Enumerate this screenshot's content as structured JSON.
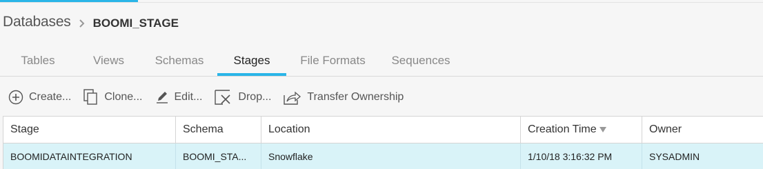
{
  "breadcrumb": {
    "root": "Databases",
    "current": "BOOMI_STAGE"
  },
  "tabs": [
    {
      "label": "Tables",
      "active": false
    },
    {
      "label": "Views",
      "active": false
    },
    {
      "label": "Schemas",
      "active": false
    },
    {
      "label": "Stages",
      "active": true
    },
    {
      "label": "File Formats",
      "active": false
    },
    {
      "label": "Sequences",
      "active": false
    }
  ],
  "toolbar": {
    "create": {
      "label": "Create...",
      "icon": "plus-circle-icon"
    },
    "clone": {
      "label": "Clone...",
      "icon": "copy-icon"
    },
    "edit": {
      "label": "Edit...",
      "icon": "pencil-icon"
    },
    "drop": {
      "label": "Drop...",
      "icon": "delete-x-icon"
    },
    "transfer": {
      "label": "Transfer Ownership",
      "icon": "share-arrow-icon"
    }
  },
  "table": {
    "columns": [
      "Stage",
      "Schema",
      "Location",
      "Creation Time",
      "Owner"
    ],
    "sorted_column": "Creation Time",
    "rows": [
      [
        "BOOMIDATAINTEGRATION",
        "BOOMI_STA...",
        "Snowflake",
        "1/10/18 3:16:32 PM",
        "SYSADMIN"
      ]
    ]
  },
  "colors": {
    "accent": "#29b5e8",
    "selected_row": "#d9f3f8"
  }
}
